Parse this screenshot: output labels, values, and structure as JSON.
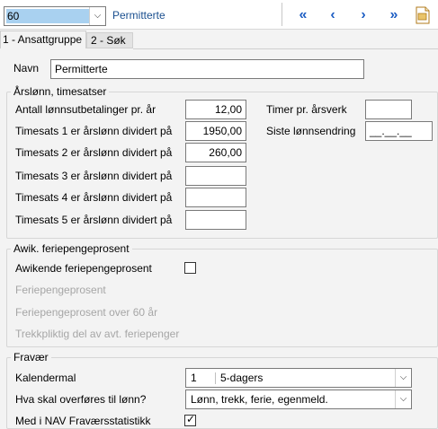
{
  "toolbar": {
    "record_value": "60",
    "record_name": "Permitterte",
    "first_glyph": "«",
    "prev_glyph": "‹",
    "next_glyph": "›",
    "last_glyph": "»"
  },
  "tabs": [
    {
      "label": "1 - Ansattgruppe",
      "active": true
    },
    {
      "label": "2 - Søk",
      "active": false
    }
  ],
  "navn": {
    "label": "Navn",
    "value": "Permitterte"
  },
  "arslonn": {
    "title": "Årslønn, timesatser",
    "rows": [
      {
        "label": "Antall lønnsutbetalinger pr. år",
        "value": "12,00"
      },
      {
        "label": "Timesats 1 er årslønn dividert på",
        "value": "1950,00"
      },
      {
        "label": "Timesats 2 er årslønn dividert på",
        "value": "260,00"
      },
      {
        "label": "Timesats 3 er årslønn dividert på",
        "value": ""
      },
      {
        "label": "Timesats 4 er årslønn dividert på",
        "value": ""
      },
      {
        "label": "Timesats 5 er årslønn dividert på",
        "value": ""
      }
    ],
    "timer_label": "Timer pr. årsverk",
    "timer_value": "",
    "siste_label": "Siste lønnsendring",
    "siste_value": "__.__.__"
  },
  "ferie": {
    "title": "Awik. feriepengeprosent",
    "awik_label": "Awikende feriepengeprosent",
    "awik_checked": false,
    "prosent_label": "Feriepengeprosent",
    "over60_label": "Feriepengeprosent over 60 år",
    "trekk_label": "Trekkpliktig del av avt. feriepenger"
  },
  "fravaer": {
    "title": "Fravær",
    "kalender_label": "Kalendermal",
    "kalender_code": "1",
    "kalender_name": "5-dagers",
    "overfor_label": "Hva skal overføres til lønn?",
    "overfor_value": "Lønn, trekk, ferie, egenmeld.",
    "nav_label": "Med i NAV Fraværsstatistikk",
    "nav_checked": true,
    "check_glyph": "✓"
  }
}
